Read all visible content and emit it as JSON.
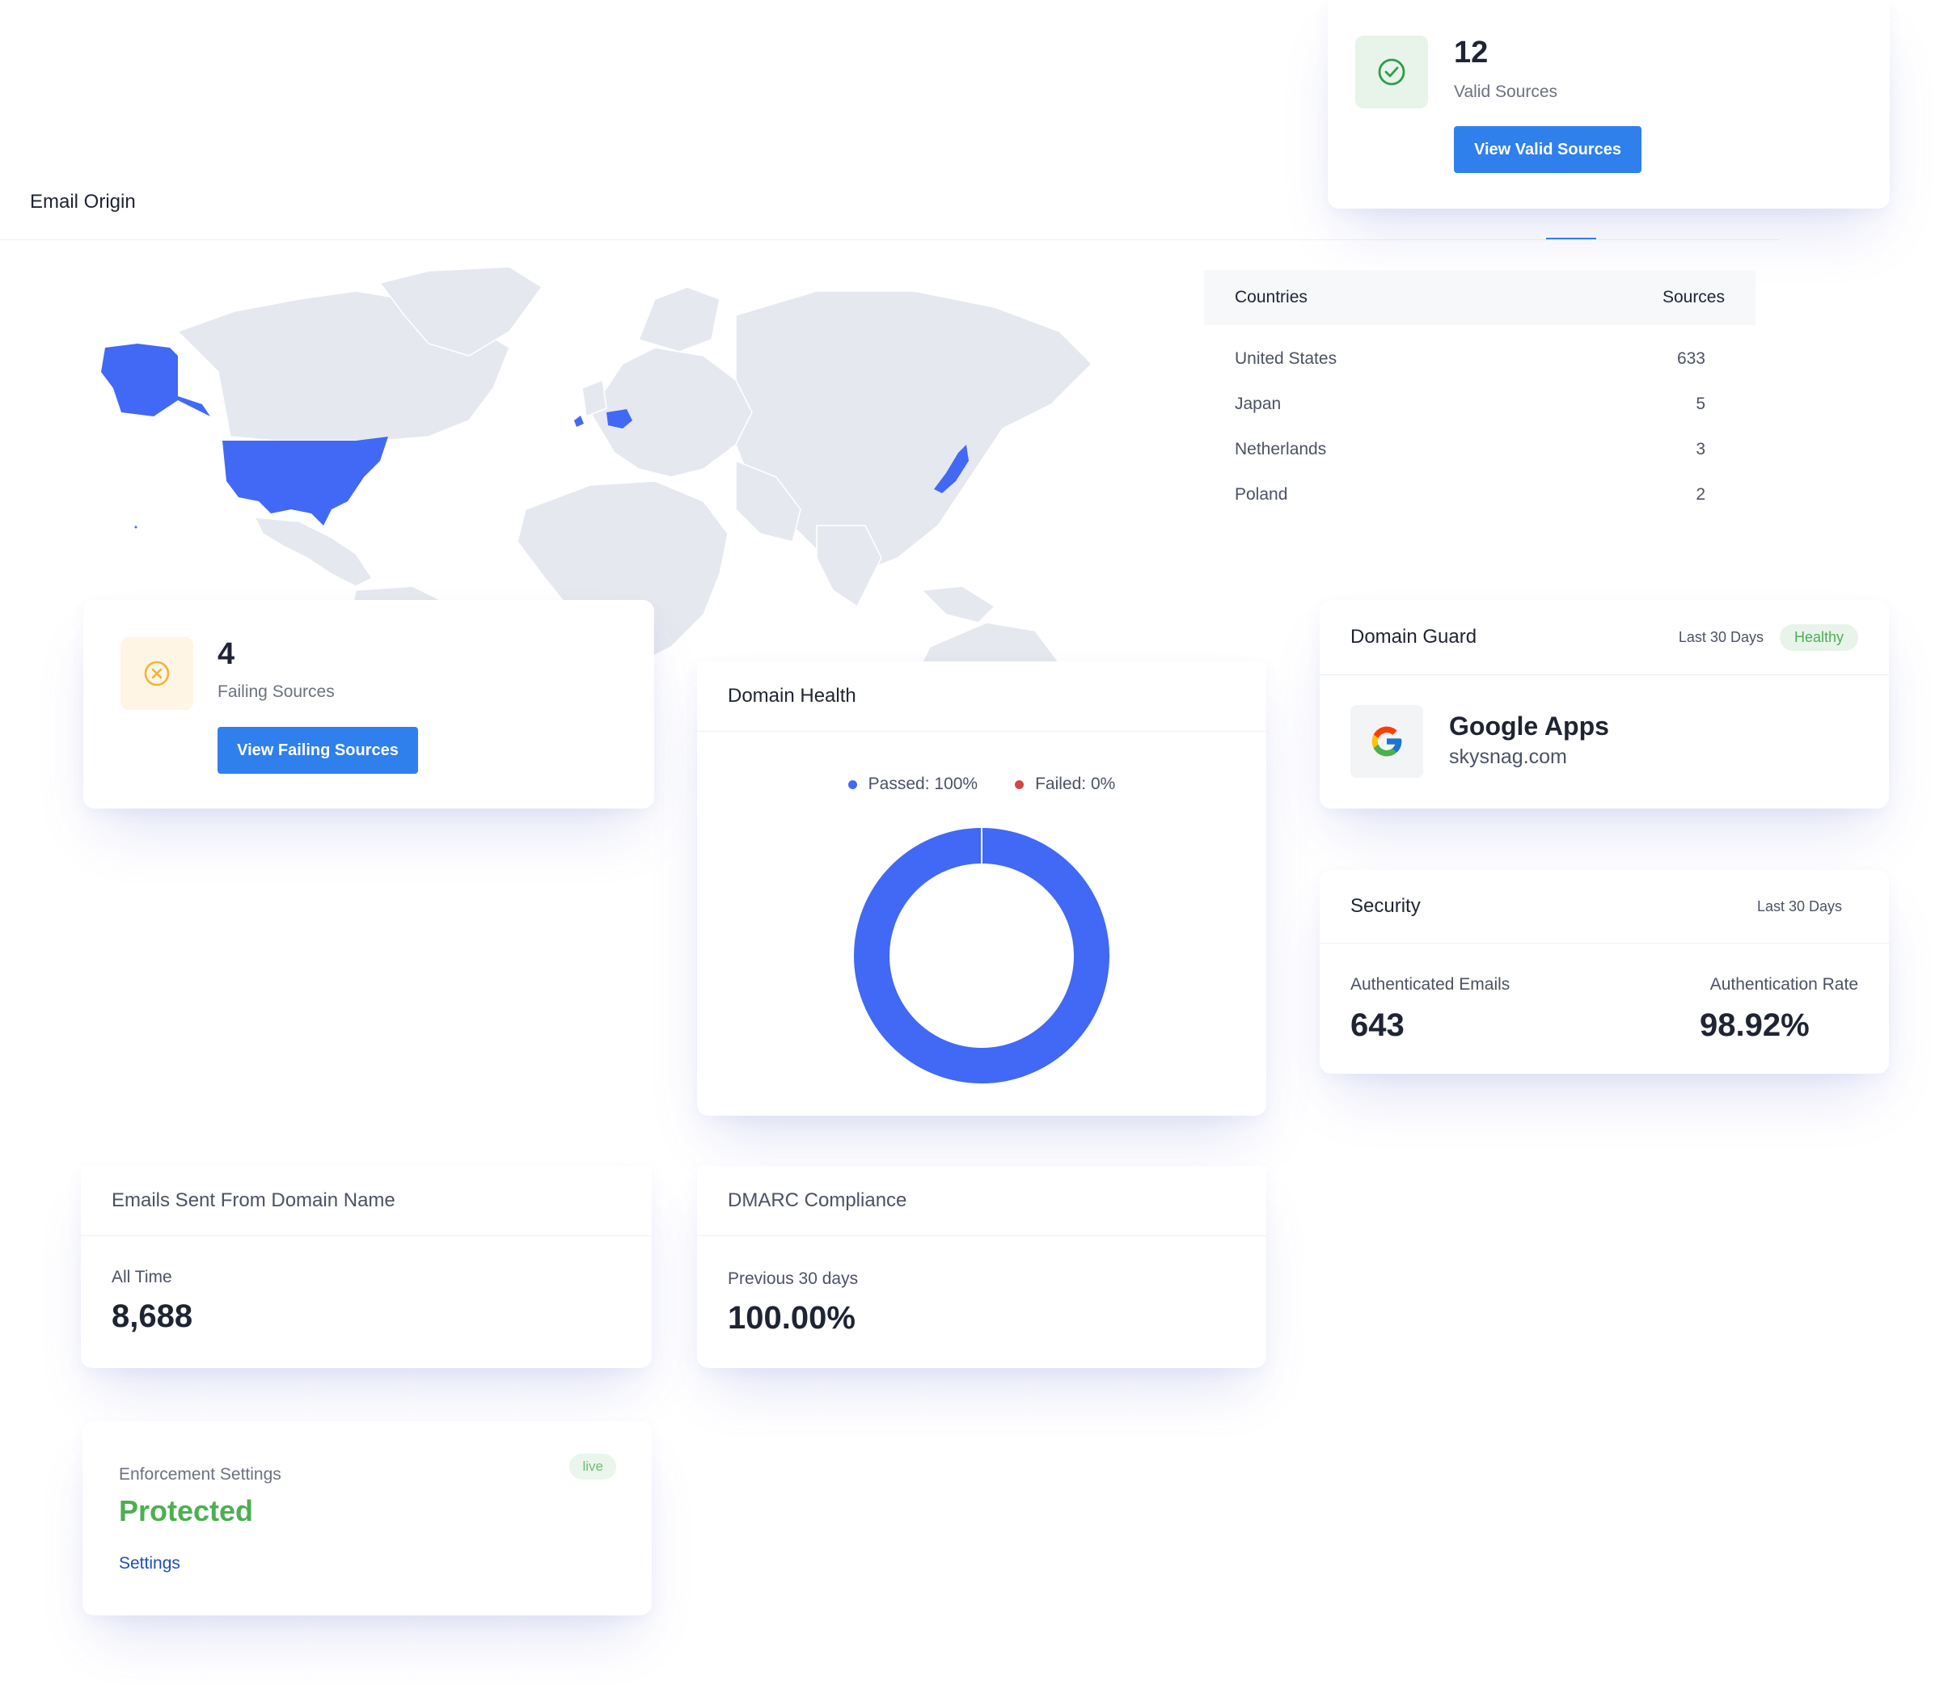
{
  "page": {
    "title": "Email Origin"
  },
  "valid_card": {
    "count": "12",
    "label": "Valid Sources",
    "button": "View Valid Sources",
    "accent": "#2e9e47"
  },
  "failing_card": {
    "count": "4",
    "label": "Failing Sources",
    "button": "View Failing Sources",
    "accent": "#f2b33d"
  },
  "countries_table": {
    "col_country": "Countries",
    "col_sources": "Sources",
    "rows": [
      {
        "country": "United States",
        "sources": "633"
      },
      {
        "country": "Japan",
        "sources": "5"
      },
      {
        "country": "Netherlands",
        "sources": "3"
      },
      {
        "country": "Poland",
        "sources": "2"
      }
    ]
  },
  "domain_health": {
    "title": "Domain Health",
    "legend_passed": "Passed: 100%",
    "legend_failed": "Failed: 0%",
    "passed_color": "#4169f5",
    "failed_color": "#d64545"
  },
  "chart_data": {
    "type": "pie",
    "title": "Domain Health",
    "categories": [
      "Passed",
      "Failed"
    ],
    "values": [
      100,
      0
    ]
  },
  "domain_guard": {
    "title": "Domain Guard",
    "range": "Last 30 Days",
    "status": "Healthy",
    "provider_name": "Google Apps",
    "provider_domain": "skysnag.com",
    "provider_icon": "google-icon"
  },
  "security": {
    "title": "Security",
    "range": "Last 30 Days",
    "auth_emails_label": "Authenticated Emails",
    "auth_emails_value": "643",
    "auth_rate_label": "Authentication Rate",
    "auth_rate_value": "98.92%"
  },
  "emails_sent": {
    "title": "Emails Sent From Domain Name",
    "period": "All Time",
    "value": "8,688"
  },
  "dmarc": {
    "title": "DMARC Compliance",
    "period": "Previous 30 days",
    "value": "100.00%"
  },
  "enforcement": {
    "title": "Enforcement Settings",
    "badge": "live",
    "status": "Protected",
    "link": "Settings",
    "status_color": "#4caf50"
  },
  "map": {
    "highlight_color": "#4169f5",
    "land_color": "#e6e8ef",
    "highlighted_regions": [
      "United States",
      "Japan",
      "Netherlands",
      "Poland"
    ]
  }
}
